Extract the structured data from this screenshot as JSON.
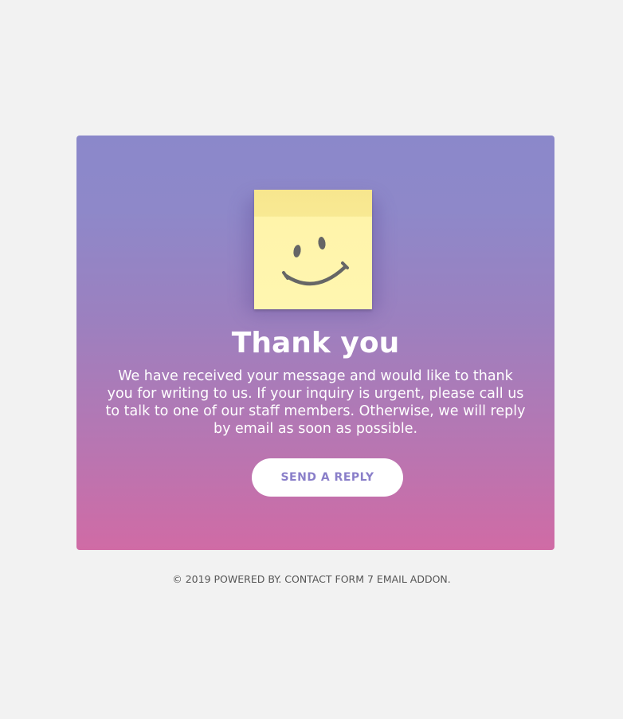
{
  "card": {
    "title": "Thank you",
    "message": "We have received your message and would like to thank you for writing to us. If your inquiry is urgent, please call us to talk to one of our staff members. Otherwise, we will reply by email as soon as possible.",
    "button_label": "SEND A REPLY",
    "icon": "smiley-sticky-note-icon",
    "gradient_top": "#8b88ca",
    "gradient_bottom": "#d06ba5"
  },
  "footer": {
    "text": "© 2019 POWERED BY. CONTACT FORM 7 EMAIL ADDON."
  },
  "colors": {
    "page_background": "#f2f2f2",
    "button_text": "#8a7fc9",
    "note_yellow": "#fff6b0"
  }
}
